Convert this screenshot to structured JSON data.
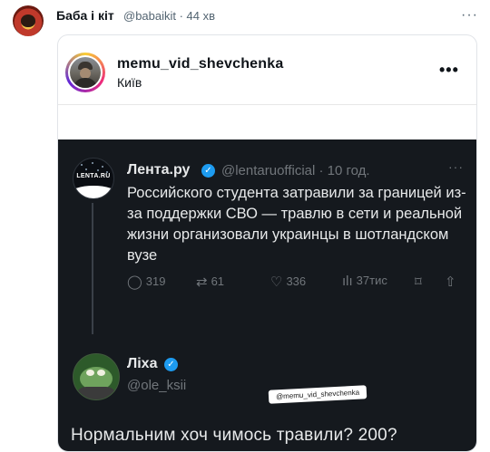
{
  "tweet": {
    "author_name": "Баба і кіт",
    "author_handle_time": "@babaikit · 44 хв",
    "more": "···"
  },
  "instagram_header": {
    "username": "memu_vid_shevchenka",
    "location": "Київ",
    "more": "•••"
  },
  "quoted": {
    "lenta": {
      "logo_text": "LENTA.RU",
      "name": "Лента.ру",
      "verified": "✓",
      "handle_time": "@lentaruofficial · 10 год.",
      "more": "···",
      "text": "Российского студента затравили за границей из-за поддержки СВО — травлю в сети и реальной жизни организовали украинцы в шотландском вузе",
      "stats": {
        "replies": "319",
        "retweets": "61",
        "likes": "336",
        "views": "37тис"
      },
      "icons": [
        "reply-icon",
        "retweet-icon",
        "heart-icon",
        "views-icon",
        "bookmark-icon",
        "share-icon"
      ]
    },
    "reply": {
      "name": "Ліха",
      "verified": "✓",
      "handle": "@ole_ksii",
      "text": "Нормальним хоч чимось травили? 200?"
    },
    "watermark": "@memu_vid_shevchenka"
  },
  "colors": {
    "dark_bg": "#15191e",
    "verified_blue": "#1d9bf0",
    "muted_text": "#71767b"
  }
}
